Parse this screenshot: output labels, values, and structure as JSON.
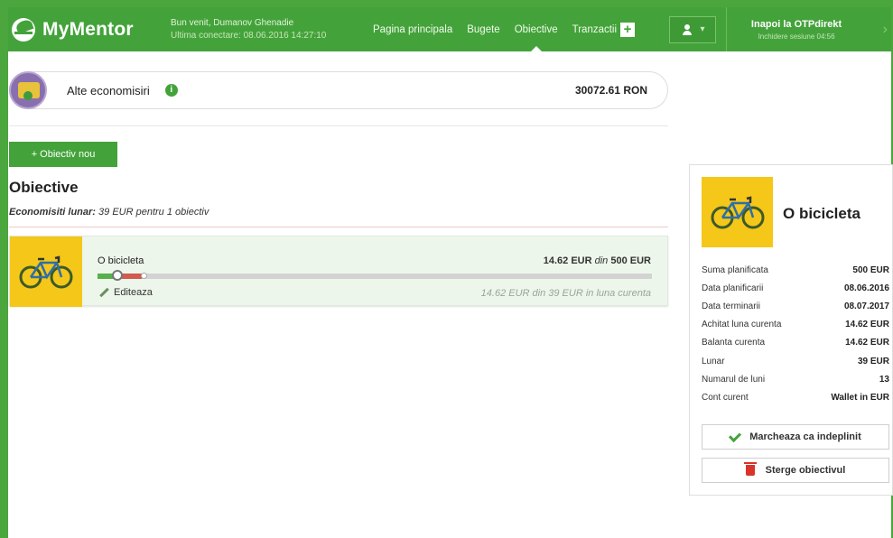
{
  "app": {
    "name": "MyMentor"
  },
  "header": {
    "welcome": "Bun venit, Dumanov Ghenadie",
    "last_login": "Ultima conectare: 08.06.2016 14:27:10",
    "nav": [
      {
        "label": "Pagina principala"
      },
      {
        "label": "Bugete"
      },
      {
        "label": "Obiective",
        "active": true
      },
      {
        "label": "Tranzactii"
      }
    ],
    "plus": "+",
    "back": {
      "title": "Inapoi la OTPdirekt",
      "session": "Inchidere sesiune 04:56"
    }
  },
  "savings": {
    "label": "Alte economisiri",
    "info": "i",
    "value": "30072.61 RON"
  },
  "objectives": {
    "new_button": "+ Obiectiv nou",
    "title": "Obiective",
    "summary_bold": "Economisiti lunar:",
    "summary_rest": " 39 EUR pentru 1 obiectiv",
    "items": [
      {
        "name": "O bicicleta",
        "amount": "14.62 EUR",
        "amount_of": "din",
        "amount_total": "500 EUR",
        "progress_percent": 3,
        "edit": "Editeaza",
        "month_line": "14.62 EUR din 39 EUR in luna curenta"
      }
    ]
  },
  "detail": {
    "title": "O bicicleta",
    "rows": [
      {
        "label": "Suma planificata",
        "value": "500 EUR"
      },
      {
        "label": "Data planificarii",
        "value": "08.06.2016"
      },
      {
        "label": "Data terminarii",
        "value": "08.07.2017"
      },
      {
        "label": "Achitat luna curenta",
        "value": "14.62 EUR"
      },
      {
        "label": "Balanta curenta",
        "value": "14.62 EUR"
      },
      {
        "label": "Lunar",
        "value": "39 EUR"
      },
      {
        "label": "Numarul de luni",
        "value": "13"
      },
      {
        "label": "Cont curent",
        "value": "Wallet in EUR"
      }
    ],
    "mark_done": "Marcheaza ca indeplinit",
    "delete": "Sterge obiectivul"
  },
  "colors": {
    "brand": "#43a33a",
    "goal_bg": "#f4c719",
    "danger": "#d9342b"
  }
}
